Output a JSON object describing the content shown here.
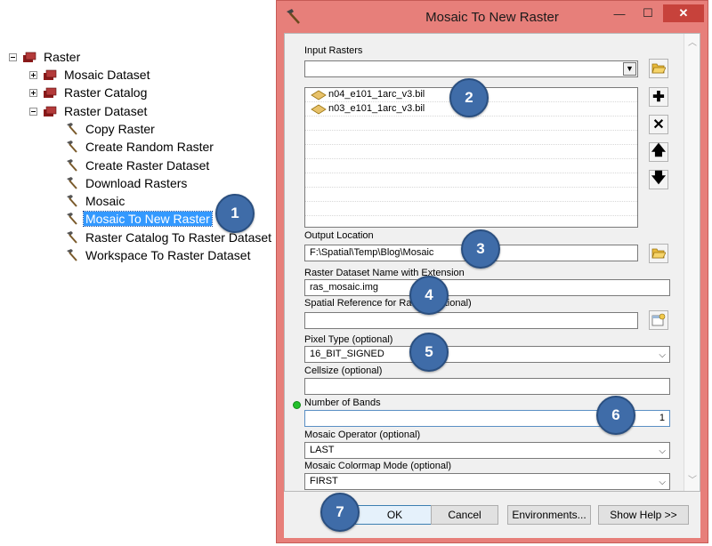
{
  "tree": {
    "root": {
      "label": "Raster",
      "expanded": true
    },
    "children": [
      {
        "label": "Mosaic Dataset",
        "expanded": false
      },
      {
        "label": "Raster Catalog",
        "expanded": false
      },
      {
        "label": "Raster Dataset",
        "expanded": true
      }
    ],
    "tools": [
      "Copy Raster",
      "Create Random Raster",
      "Create Raster Dataset",
      "Download Rasters",
      "Mosaic",
      "Mosaic To New Raster",
      "Raster Catalog To Raster Dataset",
      "Workspace To Raster Dataset"
    ],
    "selected_tool": "Mosaic To New Raster"
  },
  "dialog": {
    "title": "Mosaic To New Raster",
    "window_buttons": {
      "minimize": "—",
      "maximize": "☐",
      "close": "✕"
    },
    "input_rasters": {
      "label": "Input Rasters",
      "combo_value": "",
      "items": [
        "n04_e101_1arc_v3.bil",
        "n03_e101_1arc_v3.bil"
      ],
      "buttons": {
        "add": "✚",
        "remove": "✕",
        "up": "🡅",
        "down": "🡇"
      }
    },
    "output_location": {
      "label": "Output Location",
      "value": "F:\\Spatial\\Temp\\Blog\\Mosaic"
    },
    "dataset_name": {
      "label": "Raster Dataset Name with Extension",
      "value": "ras_mosaic.img"
    },
    "spatial_reference": {
      "label": "Spatial Reference for Raster (optional)",
      "value": ""
    },
    "pixel_type": {
      "label": "Pixel Type (optional)",
      "value": "16_BIT_SIGNED"
    },
    "cellsize": {
      "label": "Cellsize (optional)",
      "value": ""
    },
    "number_of_bands": {
      "label": "Number of Bands",
      "value": "1"
    },
    "mosaic_operator": {
      "label": "Mosaic Operator (optional)",
      "value": "LAST"
    },
    "colormap_mode": {
      "label": "Mosaic Colormap Mode (optional)",
      "value": "FIRST"
    },
    "buttons": {
      "ok": "OK",
      "cancel": "Cancel",
      "environments": "Environments...",
      "show_help": "Show Help >>"
    }
  },
  "callouts": [
    "1",
    "2",
    "3",
    "4",
    "5",
    "6",
    "7"
  ],
  "colors": {
    "titlebar": "#e77f7a",
    "callout": "#3f6ca8",
    "selection": "#3399ff"
  }
}
